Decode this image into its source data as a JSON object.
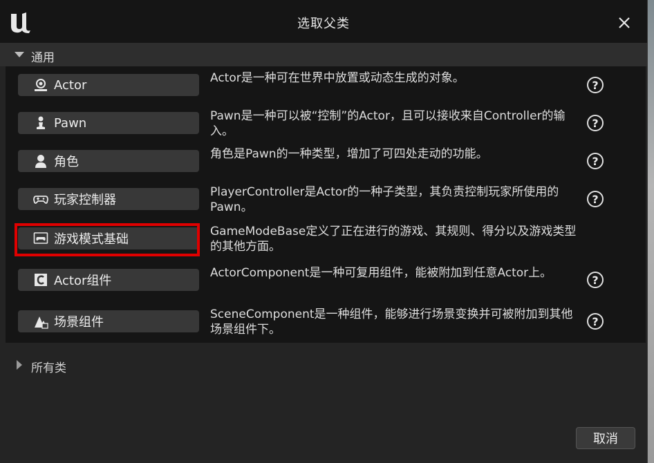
{
  "dialog": {
    "title": "选取父类"
  },
  "common": {
    "header": "通用",
    "items": [
      {
        "label": "Actor",
        "icon": "actor-icon",
        "description": "Actor是一种可在世界中放置或动态生成的对象。"
      },
      {
        "label": "Pawn",
        "icon": "pawn-icon",
        "description": "Pawn是一种可以被“控制”的Actor，且可以接收来自Controller的输入。"
      },
      {
        "label": "角色",
        "icon": "character-icon",
        "description": "角色是Pawn的一种类型，增加了可四处走动的功能。"
      },
      {
        "label": "玩家控制器",
        "icon": "gamepad-icon",
        "description": "PlayerController是Actor的一种子类型，其负责控制玩家所使用的Pawn。"
      },
      {
        "label": "游戏模式基础",
        "icon": "game-mode-icon",
        "description": "GameModeBase定义了正在进行的游戏、其规则、得分以及游戏类型的其他方面。"
      },
      {
        "label": "Actor组件",
        "icon": "actor-component-icon",
        "description": "ActorComponent是一种可复用组件，能被附加到任意Actor上。"
      },
      {
        "label": "场景组件",
        "icon": "scene-component-icon",
        "description": "SceneComponent是一种组件，能够进行场景变换并可被附加到其他场景组件下。"
      }
    ],
    "help_glyph": "?"
  },
  "all_classes": {
    "header": "所有类"
  },
  "footer": {
    "cancel_label": "取消"
  },
  "colors": {
    "highlight": "#e00000",
    "panel": "#242424",
    "titlebar": "#151515",
    "button": "#383838"
  }
}
